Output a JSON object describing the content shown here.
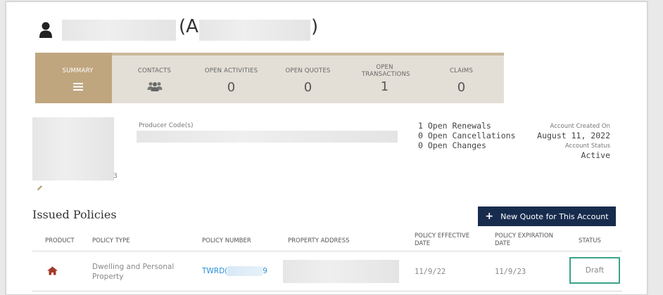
{
  "header": {
    "name_open": "(A",
    "name_close": ")"
  },
  "tiles": [
    {
      "label": "SUMMARY",
      "icon": "menu-icon",
      "active": true
    },
    {
      "label": "CONTACTS",
      "icon": "people-icon"
    },
    {
      "label": "OPEN ACTIVITIES",
      "count": "0"
    },
    {
      "label": "OPEN QUOTES",
      "count": "0"
    },
    {
      "label": "OPEN TRANSACTIONS",
      "count": "1"
    },
    {
      "label": "CLAIMS",
      "count": "0"
    }
  ],
  "account": {
    "producer_label": "Producer Code(s)",
    "digit_fragment": "3",
    "open_renewals": "1 Open Renewals",
    "open_cancellations": "0 Open Cancellations",
    "open_changes": "0 Open Changes",
    "created_label": "Account Created On",
    "created_value": "August 11, 2022",
    "status_label": "Account Status",
    "status_value": "Active"
  },
  "policies": {
    "title": "Issued Policies",
    "new_quote_label": "New Quote for This Account",
    "columns": [
      "PRODUCT",
      "POLICY TYPE",
      "POLICY NUMBER",
      "PROPERTY ADDRESS",
      "POLICY EFFECTIVE DATE",
      "POLICY EXPIRATION DATE",
      "STATUS"
    ],
    "rows": [
      {
        "product_icon": "house-icon",
        "policy_type": "Dwelling and Personal Property",
        "policy_number_prefix": "TWRD(",
        "policy_number_suffix": "9",
        "effective": "11/9/22",
        "expiration": "11/9/23",
        "status": "Draft"
      }
    ]
  },
  "colors": {
    "tile_active": "#bfa67f",
    "tile_bg": "#e3dfd6",
    "button": "#172b4d",
    "link": "#2a8fd8",
    "highlight": "#3aa38a"
  }
}
